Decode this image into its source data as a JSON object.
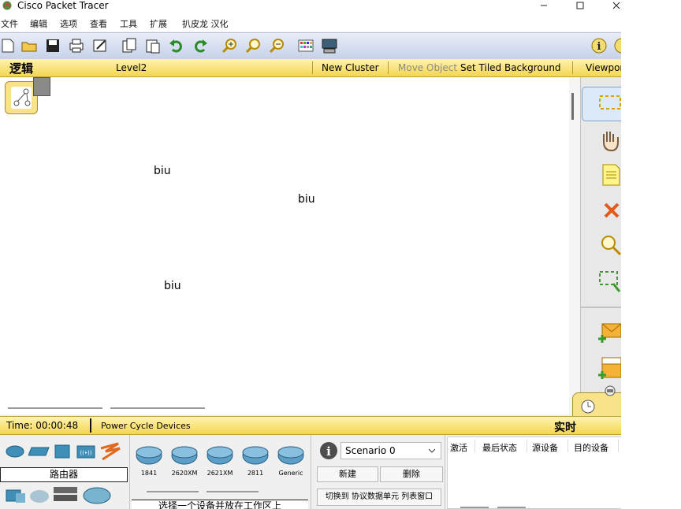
{
  "window": {
    "title": "Cisco Packet Tracer"
  },
  "menu": [
    "文件",
    "编辑",
    "选项",
    "查看",
    "工具",
    "扩展",
    "扒皮龙 汉化"
  ],
  "toolbar": {
    "icons": [
      "new-file-icon",
      "open-folder-icon",
      "save-icon",
      "print-icon",
      "activity-wizard-icon",
      "copy-icon",
      "paste-icon",
      "undo-icon",
      "redo-icon",
      "zoom-in-icon",
      "zoom-reset-icon",
      "zoom-out-icon",
      "palette-icon",
      "device-template-icon"
    ],
    "info_icon": "info-icon"
  },
  "logical_bar": {
    "mode_label": "逻辑",
    "level": "Level2",
    "new_cluster": "New Cluster",
    "move_object": "Move Object",
    "set_tiled_background": "Set Tiled Background",
    "viewport": "Viewpor"
  },
  "canvas": {
    "labels": [
      {
        "text": "biu"
      },
      {
        "text": "biu"
      },
      {
        "text": "biu"
      }
    ]
  },
  "right_tools": [
    "select-icon",
    "hand-icon",
    "note-icon",
    "delete-icon",
    "inspect-icon",
    "resize-shape-icon",
    "add-simple-pdu-icon",
    "add-complex-pdu-icon"
  ],
  "timebar": {
    "time": "Time: 00:00:48",
    "power_cycle": "Power Cycle Devices",
    "realtime": "实时"
  },
  "device_panel": {
    "category_label": "路由器",
    "models": [
      "1841",
      "2620XM",
      "2621XM",
      "2811",
      "Generic"
    ],
    "hint": "选择一个设备并放在工作区上"
  },
  "scenario": {
    "selected": "Scenario 0",
    "new_button": "新建",
    "delete_button": "删除",
    "toggle_button": "切换到 协议数据单元 列表窗口"
  },
  "pdu_table": {
    "columns": [
      "激活",
      "最后状态",
      "源设备",
      "目的设备"
    ]
  },
  "colors": {
    "accent": "#f4d64f",
    "toolbar": "#c6d2ea",
    "selection": "#7da2ce"
  }
}
